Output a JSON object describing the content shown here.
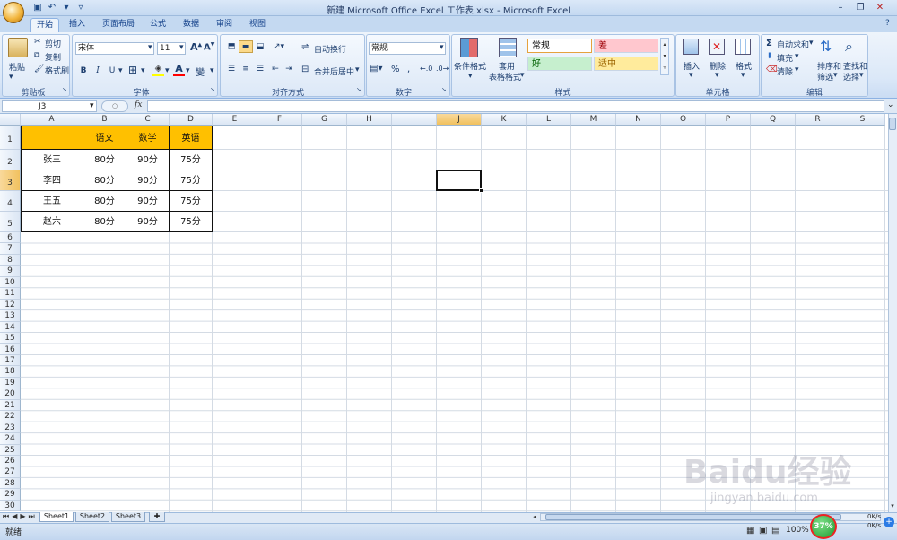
{
  "window": {
    "title": "新建 Microsoft Office Excel 工作表.xlsx - Microsoft Excel",
    "qat": [
      "save-icon",
      "undo-icon",
      "redo-icon"
    ],
    "controls": [
      "minimize-icon",
      "restore-icon",
      "close-icon"
    ]
  },
  "tabs": [
    {
      "label": "开始",
      "active": true
    },
    {
      "label": "插入",
      "active": false
    },
    {
      "label": "页面布局",
      "active": false
    },
    {
      "label": "公式",
      "active": false
    },
    {
      "label": "数据",
      "active": false
    },
    {
      "label": "审阅",
      "active": false
    },
    {
      "label": "视图",
      "active": false
    }
  ],
  "ribbon": {
    "clipboard": {
      "name": "剪贴板",
      "paste": "粘贴",
      "cut": "剪切",
      "copy": "复制",
      "format_painter": "格式刷"
    },
    "font": {
      "name": "字体",
      "family": "宋体",
      "size": "11",
      "bold": "B",
      "italic": "I",
      "underline": "U",
      "phonetic": "變"
    },
    "alignment": {
      "name": "对齐方式",
      "wrap": "自动换行",
      "merge": "合并后居中"
    },
    "number": {
      "name": "数字",
      "format": "常规",
      "percent": "%"
    },
    "styles": {
      "name": "样式",
      "conditional": "条件格式",
      "table_line1": "套用",
      "table_line2": "表格格式",
      "cells": [
        {
          "label": "常规",
          "bg": "#ffffff",
          "color": "#111111"
        },
        {
          "label": "差",
          "bg": "#ffc7ce",
          "color": "#9c0006"
        },
        {
          "label": "好",
          "bg": "#c6efce",
          "color": "#006100"
        },
        {
          "label": "适中",
          "bg": "#ffeb9c",
          "color": "#9c6500"
        }
      ]
    },
    "cells_group": {
      "name": "单元格",
      "insert": "插入",
      "delete": "删除",
      "format": "格式"
    },
    "editing": {
      "name": "编辑",
      "autosum": "自动求和",
      "fill": "填充",
      "clear": "清除",
      "sort_line1": "排序和",
      "sort_line2": "筛选",
      "find_line1": "查找和",
      "find_line2": "选择"
    }
  },
  "formula_bar": {
    "name_box": "J3",
    "fx": "fx",
    "formula": ""
  },
  "grid": {
    "columns": [
      "A",
      "B",
      "C",
      "D",
      "E",
      "F",
      "G",
      "H",
      "I",
      "J",
      "K",
      "L",
      "M",
      "N",
      "O",
      "P",
      "Q",
      "R",
      "S"
    ],
    "row_count": 30,
    "active_cell": "J3",
    "active_column": "J",
    "active_row": 3,
    "header_fill": "#ffc000",
    "data": [
      [
        "",
        "语文",
        "数学",
        "英语"
      ],
      [
        "张三",
        "80分",
        "90分",
        "75分"
      ],
      [
        "李四",
        "80分",
        "90分",
        "75分"
      ],
      [
        "王五",
        "80分",
        "90分",
        "75分"
      ],
      [
        "赵六",
        "80分",
        "90分",
        "75分"
      ]
    ]
  },
  "sheets": [
    {
      "label": "Sheet1",
      "active": true
    },
    {
      "label": "Sheet2",
      "active": false
    },
    {
      "label": "Sheet3",
      "active": false
    }
  ],
  "status": {
    "ready": "就绪",
    "zoom": "100%",
    "net_percent": "37%",
    "net_up": "0K/s",
    "net_down": "0K/s"
  },
  "watermark": {
    "brand": "Baidu经验",
    "url": "jingyan.baidu.com"
  }
}
